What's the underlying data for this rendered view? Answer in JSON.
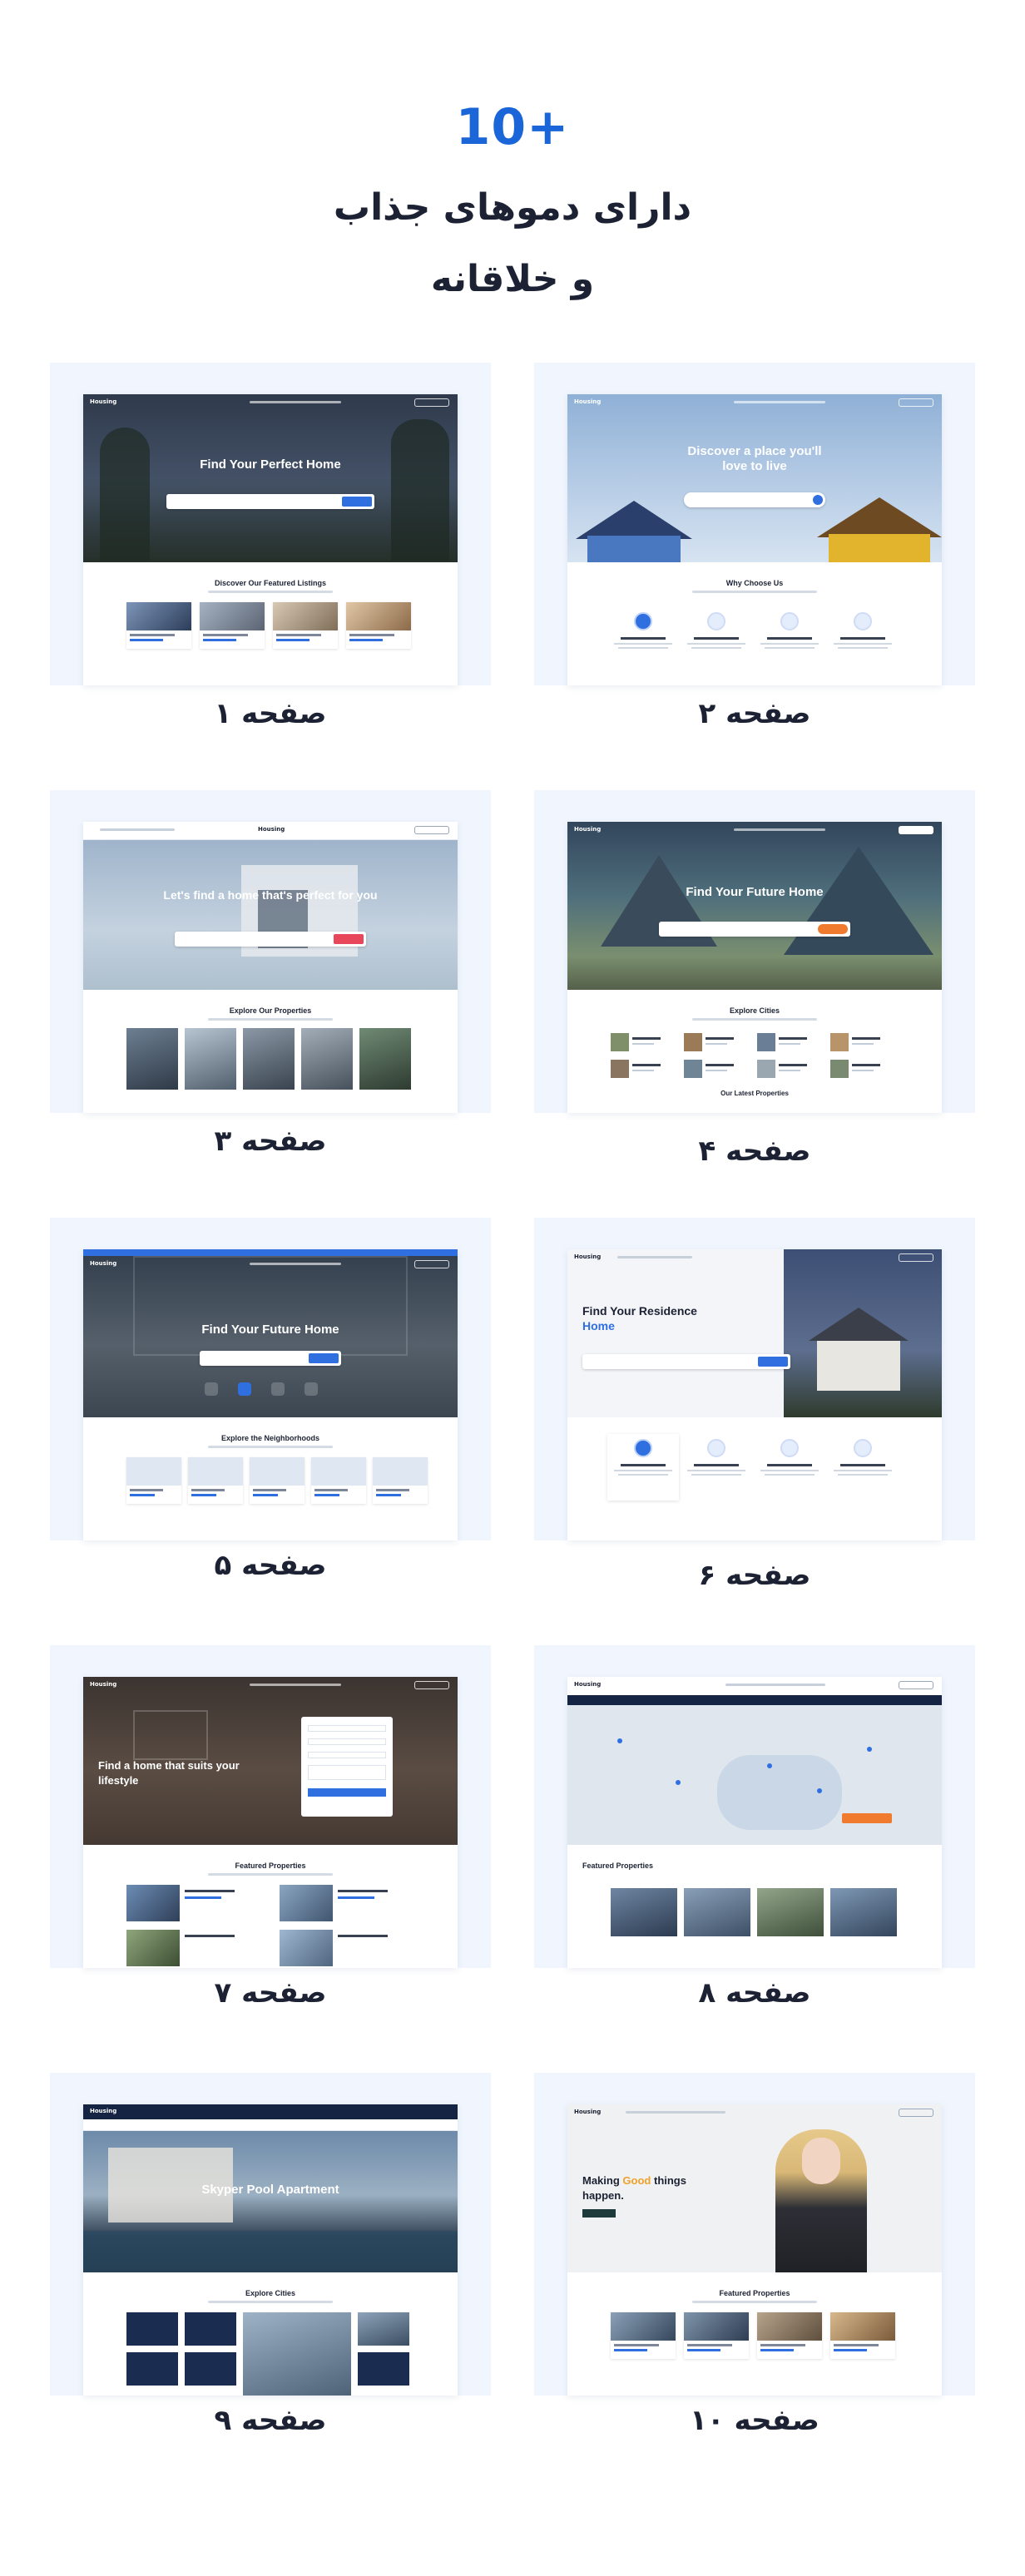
{
  "header": {
    "count": "10+",
    "title_line1": "دارای دموهای جذاب",
    "title_line2": "و خلاقانه"
  },
  "demos": [
    {
      "caption": "صفحه ۱",
      "hero_title": "Find Your Perfect Home",
      "section_title": "Discover Our Featured Listings"
    },
    {
      "caption": "صفحه ۲",
      "hero_title": "Discover a place you'll love to live",
      "section_title": "Why Choose Us"
    },
    {
      "caption": "صفحه ۳",
      "hero_title": "Let's find a home that's perfect for you",
      "section_title": "Explore Our Properties"
    },
    {
      "caption": "صفحه ۴",
      "hero_title": "Find Your Future Home",
      "section_title": "Explore Cities",
      "section_title_2": "Our Latest Properties"
    },
    {
      "caption": "صفحه ۵",
      "hero_title": "Find Your Future Home",
      "section_title": "Explore the Neighborhoods"
    },
    {
      "caption": "صفحه ۶",
      "hero_title": "Find Your Residence",
      "hero_title_accent": "Home"
    },
    {
      "caption": "صفحه ۷",
      "hero_title": "Find a home that suits your lifestyle",
      "section_title": "Featured Properties"
    },
    {
      "caption": "صفحه ۸",
      "section_title": "Featured Properties"
    },
    {
      "caption": "صفحه ۹",
      "hero_title": "Skyper Pool Apartment",
      "section_title": "Explore Cities"
    },
    {
      "caption": "صفحه ۱۰",
      "hero_title": "Making",
      "hero_title_accent": "Good",
      "hero_title_rest": "things",
      "hero_title_line2": "happen.",
      "section_title": "Featured Properties"
    }
  ],
  "brand": {
    "logo_text": "Housing",
    "accent": "#1a66d9",
    "tile_bg": "#f1f6fe",
    "text_dark": "#1c2233"
  }
}
